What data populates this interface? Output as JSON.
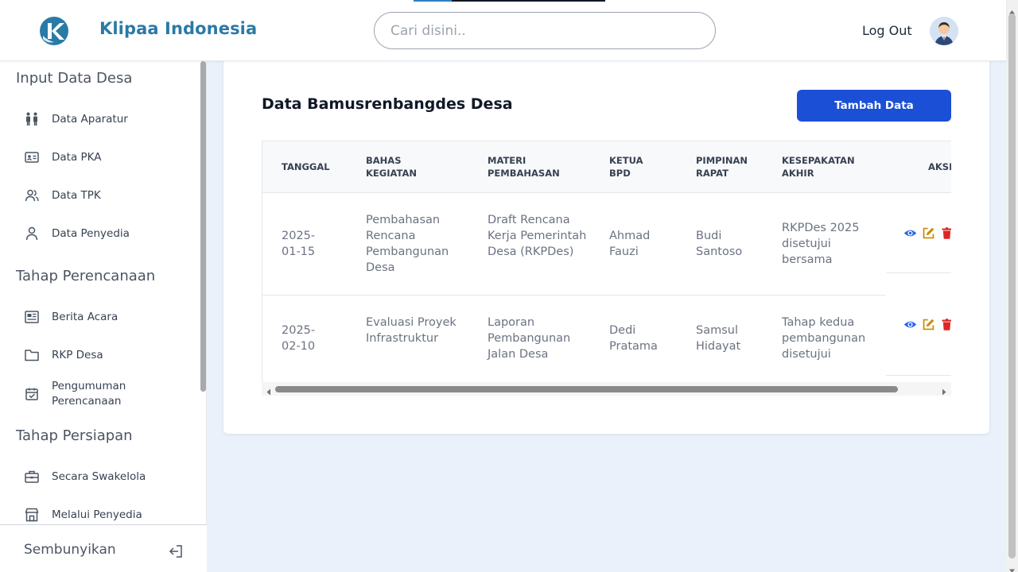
{
  "header": {
    "brand": "Klipaa Indonesia",
    "search_placeholder": "Cari disini..",
    "logout_label": "Log Out"
  },
  "sidebar": {
    "sections": [
      {
        "title": "Input Data Desa",
        "items": [
          {
            "label": "Data Aparatur",
            "icon": "people-icon"
          },
          {
            "label": "Data PKA",
            "icon": "id-card-icon"
          },
          {
            "label": "Data TPK",
            "icon": "users-icon"
          },
          {
            "label": "Data Penyedia",
            "icon": "user-icon"
          }
        ]
      },
      {
        "title": "Tahap Perencanaan",
        "items": [
          {
            "label": "Berita Acara",
            "icon": "newspaper-icon"
          },
          {
            "label": "RKP Desa",
            "icon": "folder-icon"
          },
          {
            "label": "Pengumuman Perencanaan",
            "icon": "calendar-check-icon"
          }
        ]
      },
      {
        "title": "Tahap Persiapan",
        "items": [
          {
            "label": "Secara Swakelola",
            "icon": "briefcase-icon"
          },
          {
            "label": "Melalui Penyedia",
            "icon": "store-icon"
          }
        ]
      }
    ],
    "footer_label": "Sembunyikan"
  },
  "main": {
    "title": "Data Bamusrenbangdes Desa",
    "add_button": "Tambah Data",
    "columns": [
      "TANGGAL",
      "BAHAS KEGIATAN",
      "MATERI PEMBAHASAN",
      "KETUA BPD",
      "PIMPINAN RAPAT",
      "KESEPAKATAN AKHIR",
      "AKSI"
    ],
    "rows": [
      [
        "2025-01-15",
        "Pembahasan Rencana Pembangunan Desa",
        "Draft Rencana Kerja Pemerintah Desa (RKPDes)",
        "Ahmad Fauzi",
        "Budi Santoso",
        "RKPDes 2025 disetujui bersama"
      ],
      [
        "2025-02-10",
        "Evaluasi Proyek Infrastruktur",
        "Laporan Pembangunan Jalan Desa",
        "Dedi Pratama",
        "Samsul Hidayat",
        "Tahap kedua pembangunan disetujui"
      ]
    ]
  },
  "colors": {
    "brand": "#2a7aa6",
    "primary_button": "#1a4fd6",
    "view_icon": "#2563eb",
    "edit_icon": "#ca8a04",
    "delete_icon": "#dc2626",
    "page_bg": "#eaf1fb"
  }
}
